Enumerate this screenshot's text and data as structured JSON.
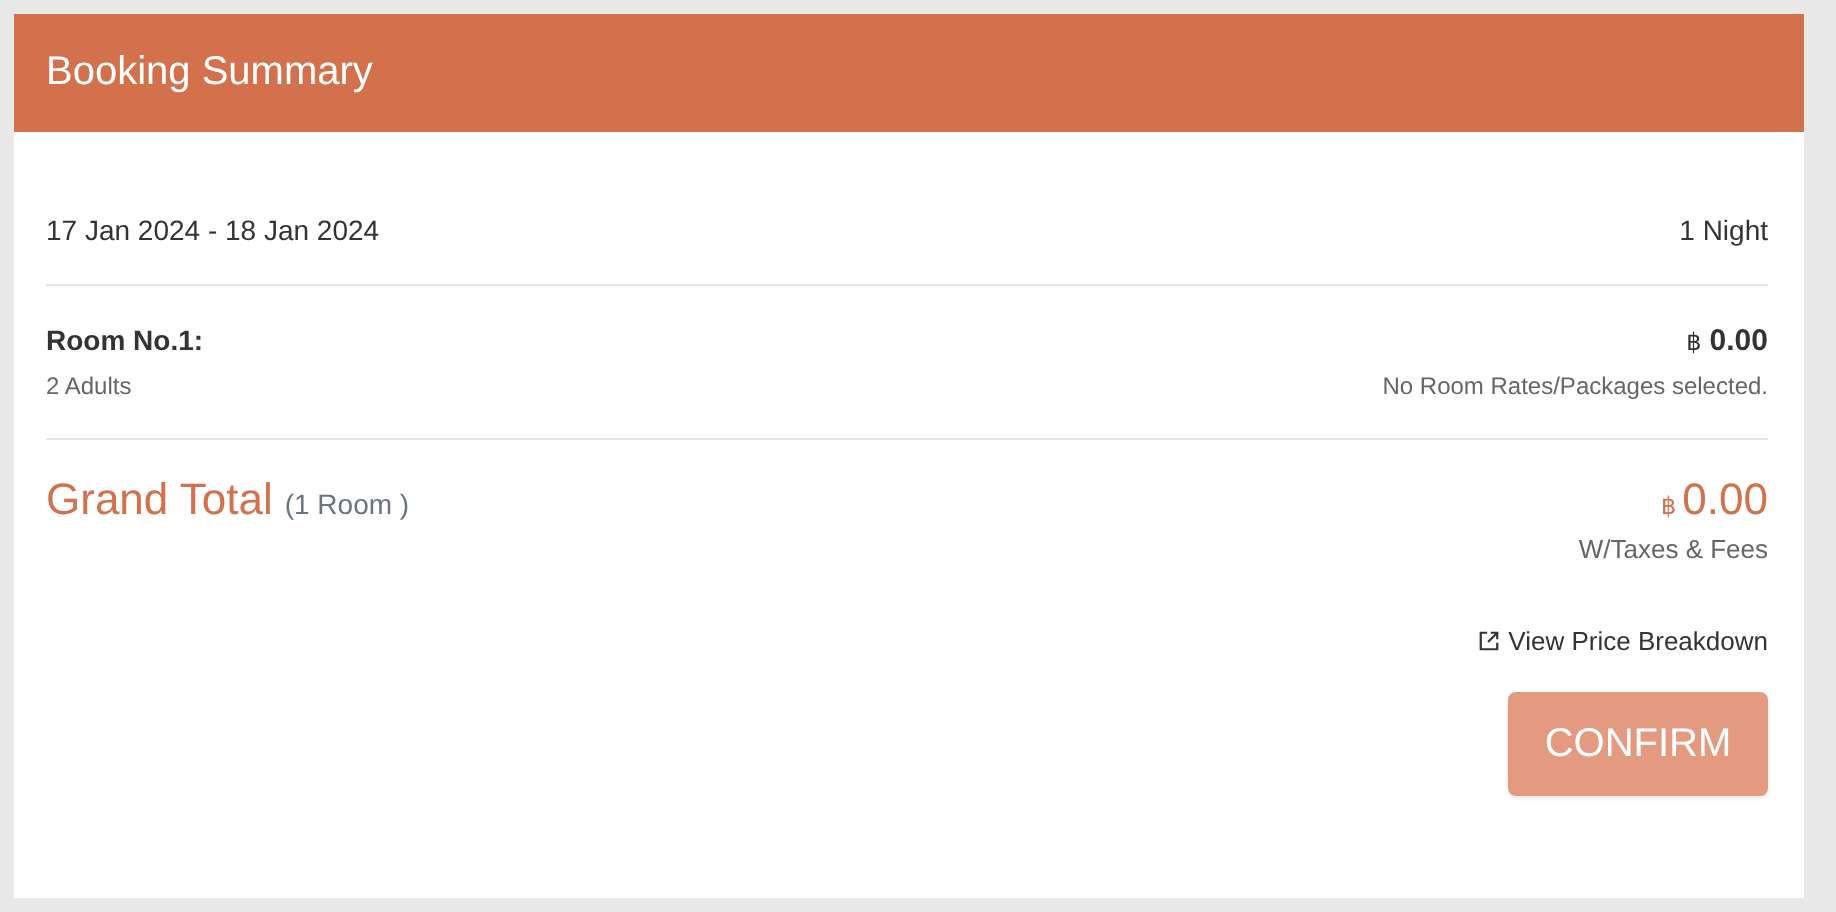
{
  "panel": {
    "title": "Booking Summary"
  },
  "stay": {
    "dates": "17 Jan 2024 - 18 Jan 2024",
    "nights": "1 Night"
  },
  "rooms": [
    {
      "label": "Room No.1:",
      "guests": "2 Adults",
      "currency": "฿",
      "amount": "0.00",
      "note": "No Room Rates/Packages selected."
    }
  ],
  "total": {
    "label": "Grand Total",
    "count": "(1 Room )",
    "currency": "฿",
    "amount": "0.00",
    "note": "W/Taxes & Fees"
  },
  "breakdown_link": "View Price Breakdown",
  "confirm": {
    "label": "CONFIRM",
    "disabled": true
  }
}
